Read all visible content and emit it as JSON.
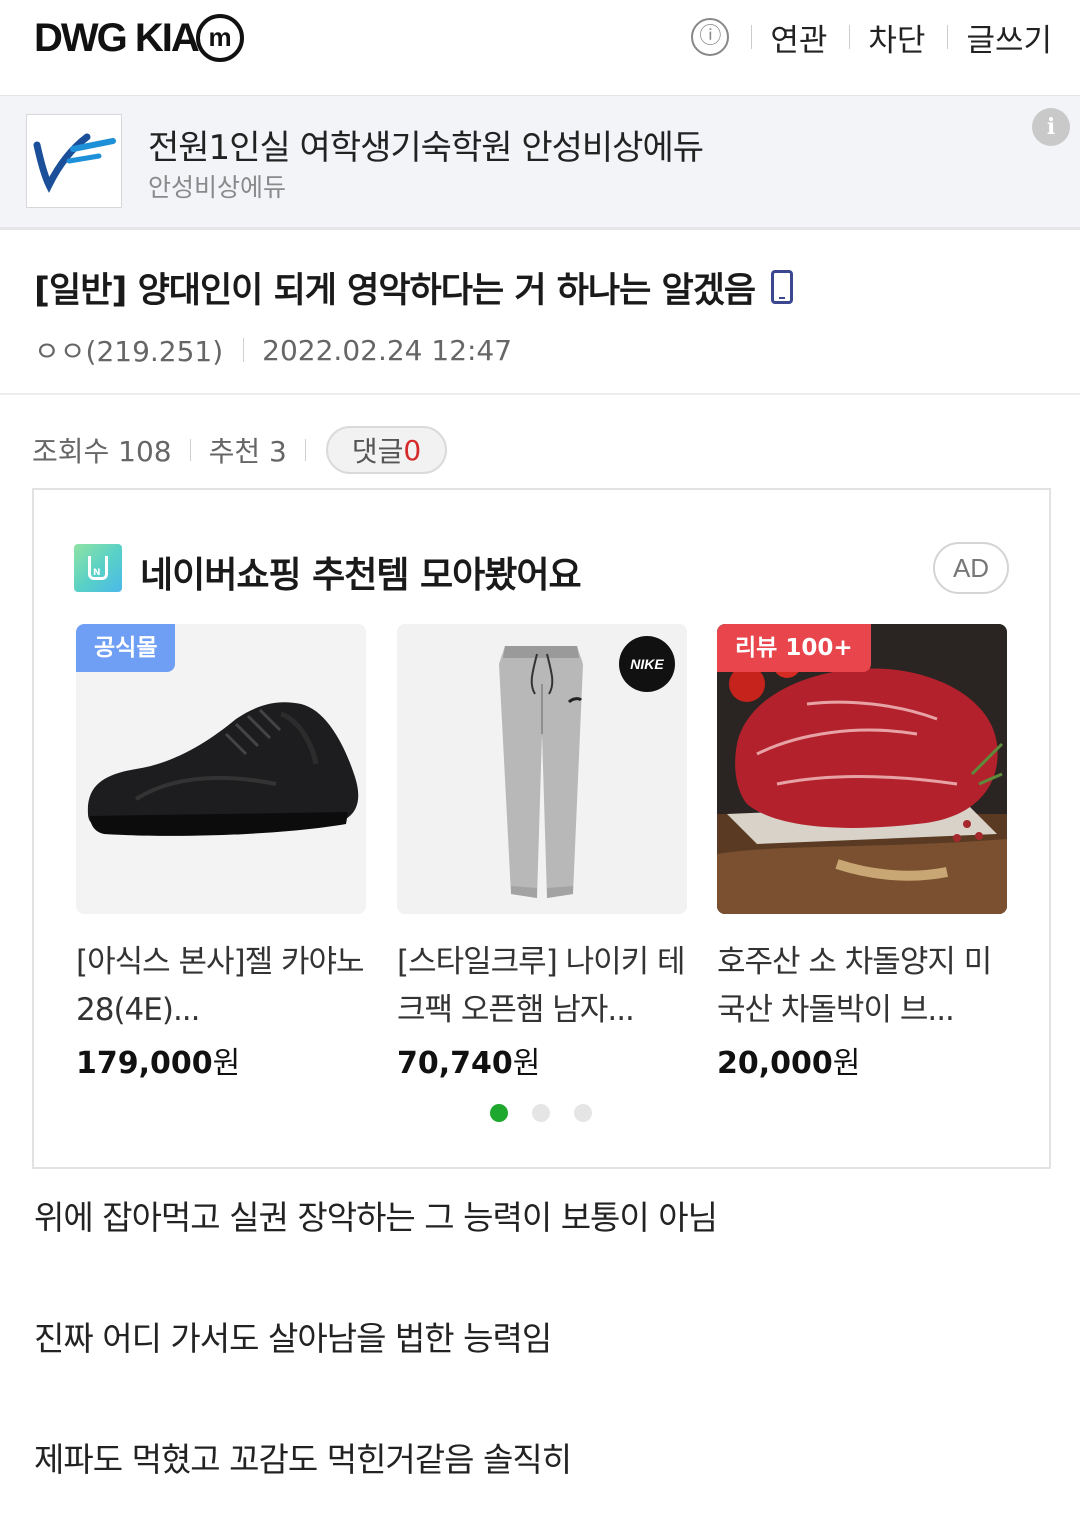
{
  "header": {
    "gallery_name": "DWG KIA",
    "minor_badge": "m",
    "info_icon": "ⓘ",
    "links": [
      "연관",
      "차단",
      "글쓰기"
    ]
  },
  "ad_banner": {
    "title": "전원1인실 여학생기숙학원 안성비상에듀",
    "subtitle": "안성비상에듀",
    "info_icon": "i"
  },
  "post": {
    "title": "[일반] 양대인이 되게 영악하다는 거 하나는 알겠음",
    "author": "ㅇㅇ(219.251)",
    "date": "2022.02.24 12:47",
    "views_label": "조회수 108",
    "recommend_label": "추천 3",
    "comment_label": "댓글",
    "comment_count": "0",
    "body": [
      "위에 잡아먹고 실권 장악하는 그 능력이 보통이 아님",
      "진짜 어디 가서도 살아남을 법한 능력임",
      "제파도 먹혔고 꼬감도 먹힌거같음 솔직히"
    ]
  },
  "shopping": {
    "heading": "네이버쇼핑 추천템 모아봤어요",
    "ad_label": "AD",
    "products": [
      {
        "tag": "공식몰",
        "tag_color": "#6f9ef5",
        "name": "[아식스 본사]젤 카야노 28(4E)...",
        "price": "179,000",
        "unit": "원"
      },
      {
        "tag": "",
        "tag_color": "",
        "name": "[스타일크루] 나이키 테크팩 오픈햄 남자...",
        "price": "70,740",
        "unit": "원",
        "brand_badge": "NIKE"
      },
      {
        "tag": "리뷰 100+",
        "tag_color": "#e8454c",
        "name": "호주산 소 차돌양지 미국산 차돌박이 브...",
        "price": "20,000",
        "unit": "원"
      }
    ],
    "page_count": 3,
    "active_page": 1
  }
}
